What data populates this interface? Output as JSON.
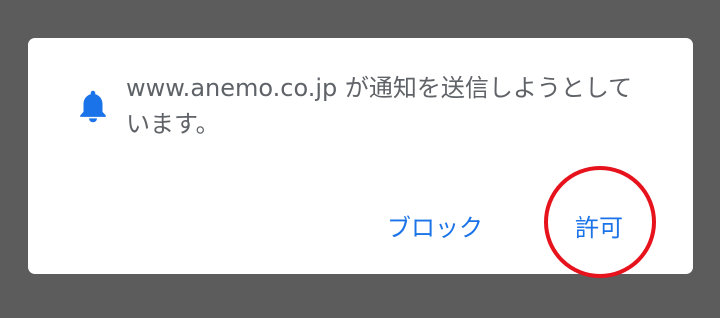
{
  "dialog": {
    "message": "www.anemo.co.jp が通知を送信しようとしています。",
    "icon": "bell-icon",
    "accent_color": "#1a73e8",
    "block_label": "ブロック",
    "allow_label": "許可"
  },
  "annotation": {
    "highlight_color": "#e6121c",
    "highlighted_target": "allow-button"
  }
}
